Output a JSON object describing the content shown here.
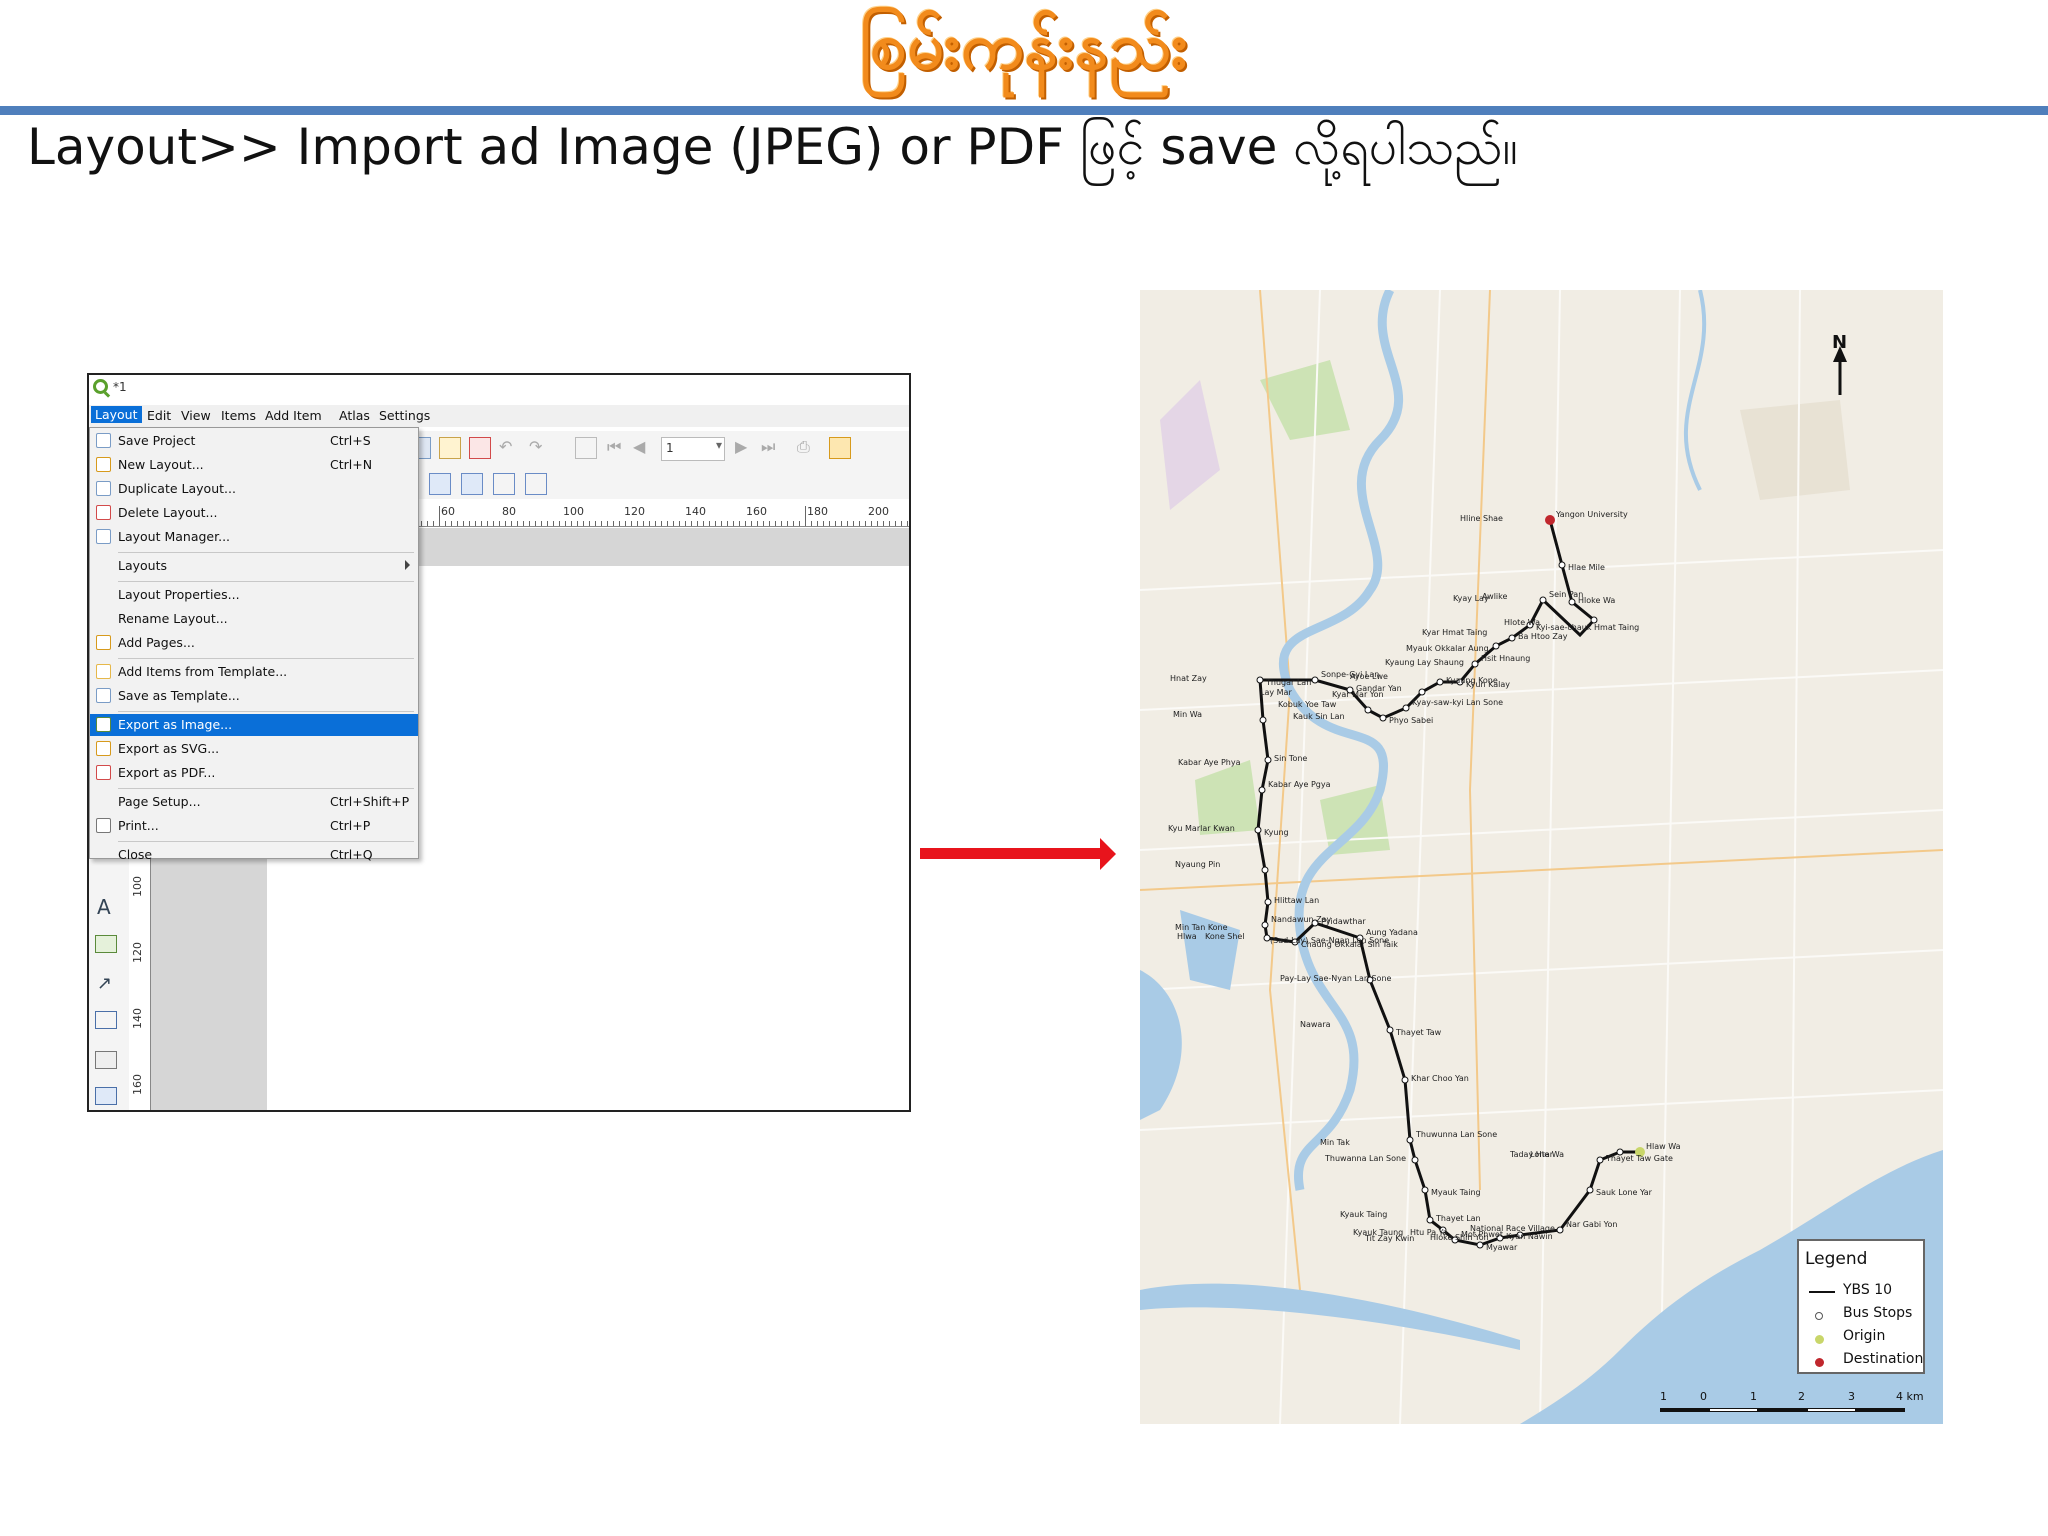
{
  "slide": {
    "banner_title": "စြမ်းကုန်းနည်း",
    "heading": "Layout>> Import ad Image (JPEG) or PDF ဖြင့် save လို့ရပါသည်။"
  },
  "qgis": {
    "window_title": "*1",
    "menubar": [
      "Layout",
      "Edit",
      "View",
      "Items",
      "Add Item",
      "Atlas",
      "Settings"
    ],
    "page_field_value": "1",
    "ruler_h_labels": [
      "60",
      "80",
      "100",
      "120",
      "140",
      "160",
      "180",
      "200"
    ],
    "ruler_v_labels": [
      "100",
      "120",
      "140",
      "160"
    ],
    "layout_menu": [
      {
        "label": "Save Project",
        "shortcut": "Ctrl+S",
        "icon": "save-icon"
      },
      {
        "label": "New Layout...",
        "shortcut": "Ctrl+N",
        "icon": "new-layout-icon"
      },
      {
        "label": "Duplicate Layout...",
        "shortcut": "",
        "icon": "duplicate-icon"
      },
      {
        "label": "Delete Layout...",
        "shortcut": "",
        "icon": "delete-icon"
      },
      {
        "label": "Layout Manager...",
        "shortcut": "",
        "icon": "layout-manager-icon"
      },
      {
        "label": "Layouts",
        "shortcut": "",
        "icon": ""
      },
      {
        "label": "Layout Properties...",
        "shortcut": "",
        "icon": ""
      },
      {
        "label": "Rename Layout...",
        "shortcut": "",
        "icon": ""
      },
      {
        "label": "Add Pages...",
        "shortcut": "",
        "icon": "add-pages-icon"
      },
      {
        "label": "Add Items from Template...",
        "shortcut": "",
        "icon": "folder-icon"
      },
      {
        "label": "Save as Template...",
        "shortcut": "",
        "icon": "save-template-icon"
      },
      {
        "label": "Export as Image...",
        "shortcut": "",
        "icon": "export-image-icon"
      },
      {
        "label": "Export as SVG...",
        "shortcut": "",
        "icon": "export-svg-icon"
      },
      {
        "label": "Export as PDF...",
        "shortcut": "",
        "icon": "export-pdf-icon"
      },
      {
        "label": "Page Setup...",
        "shortcut": "Ctrl+Shift+P",
        "icon": ""
      },
      {
        "label": "Print...",
        "shortcut": "Ctrl+P",
        "icon": "print-icon"
      },
      {
        "label": "Close",
        "shortcut": "Ctrl+Q",
        "icon": ""
      }
    ],
    "highlighted_item": "Export as Image..."
  },
  "map": {
    "north_label": "N",
    "legend": {
      "title": "Legend",
      "items": [
        {
          "label": "YBS 10",
          "symbol": "line",
          "color": "#111111"
        },
        {
          "label": "Bus Stops",
          "symbol": "circle-open",
          "color": "#555555"
        },
        {
          "label": "Origin",
          "symbol": "circle",
          "color": "#c9d66a"
        },
        {
          "label": "Destination",
          "symbol": "circle",
          "color": "#c0272d"
        }
      ]
    },
    "scalebar_labels": [
      "1",
      "0",
      "1",
      "2",
      "3",
      "4 km"
    ],
    "stop_labels": [
      "Yangon University",
      "Hline Shae",
      "Hlae Mile",
      "Awlike",
      "Hloke Wa",
      "Hlote Wa",
      "Sein Pan",
      "Kyay Lay",
      "Kyi-sae-chauk Hmat Taing",
      "Kyar Hmat Taing",
      "Ba Htoo Zay",
      "Myauk Okkalar Aung",
      "Hsit Hnaung",
      "Kyaung Lay Shaung",
      "Kyun Kalay",
      "Ayoe Lwe",
      "Kyaung Kone",
      "Kyar Mar Yon",
      "Kyay-saw-kyi Lan Sone",
      "Kauk Sin Lan",
      "Phyo Sabei",
      "Kobuk Yoe Taw",
      "Gandar Yan",
      "Lay Mar",
      "Sonpe-Gyi Lan",
      "Hnat Zay",
      "Thugar Lan",
      "Min Wa",
      "Sin Tone",
      "Kabar Aye Phya",
      "Kabar Aye Pgya",
      "Kyu Marlar Kwan",
      "Kyung",
      "Nyaung Pin",
      "Hlittaw Lan",
      "Min Tan Kone",
      "Nandawun Zay",
      "Hlwa",
      "Chaung Okkalar Sin Taik",
      "Kone Shel",
      "Pyidawthar",
      "(Sad-Lay) Sae-Ngan Lan Sone",
      "Aung Yadana",
      "Pay-Lay Sae-Nyan Lan Sone",
      "Thayet Taw",
      "Nawara",
      "Khar Choo Yan",
      "Min Tak",
      "Thuwunna Lan Sone",
      "Thuwanna Lan Sone",
      "Myauk Taing",
      "Kyauk Taing",
      "Thayet Lan",
      "Kyauk Taung",
      "Mot Phwet",
      "Tit Zay Kwin",
      "Myawar",
      "Htu Pa Ya",
      "Kyan Nawin",
      "Hloke Shin Yon",
      "Nar Gabi Yon",
      "National Race Village",
      "Sauk Lone Yar",
      "Taday Htar",
      "Thayet Taw Gate",
      "Lone Wa",
      "Hlaw Wa"
    ]
  },
  "colors": {
    "banner_orange": "#f28b1c",
    "rule_blue": "#4f7fbc",
    "menu_highlight": "#0a6fd8",
    "arrow_red": "#e8141c",
    "water": "#a9cbe6",
    "route": "#111111"
  }
}
